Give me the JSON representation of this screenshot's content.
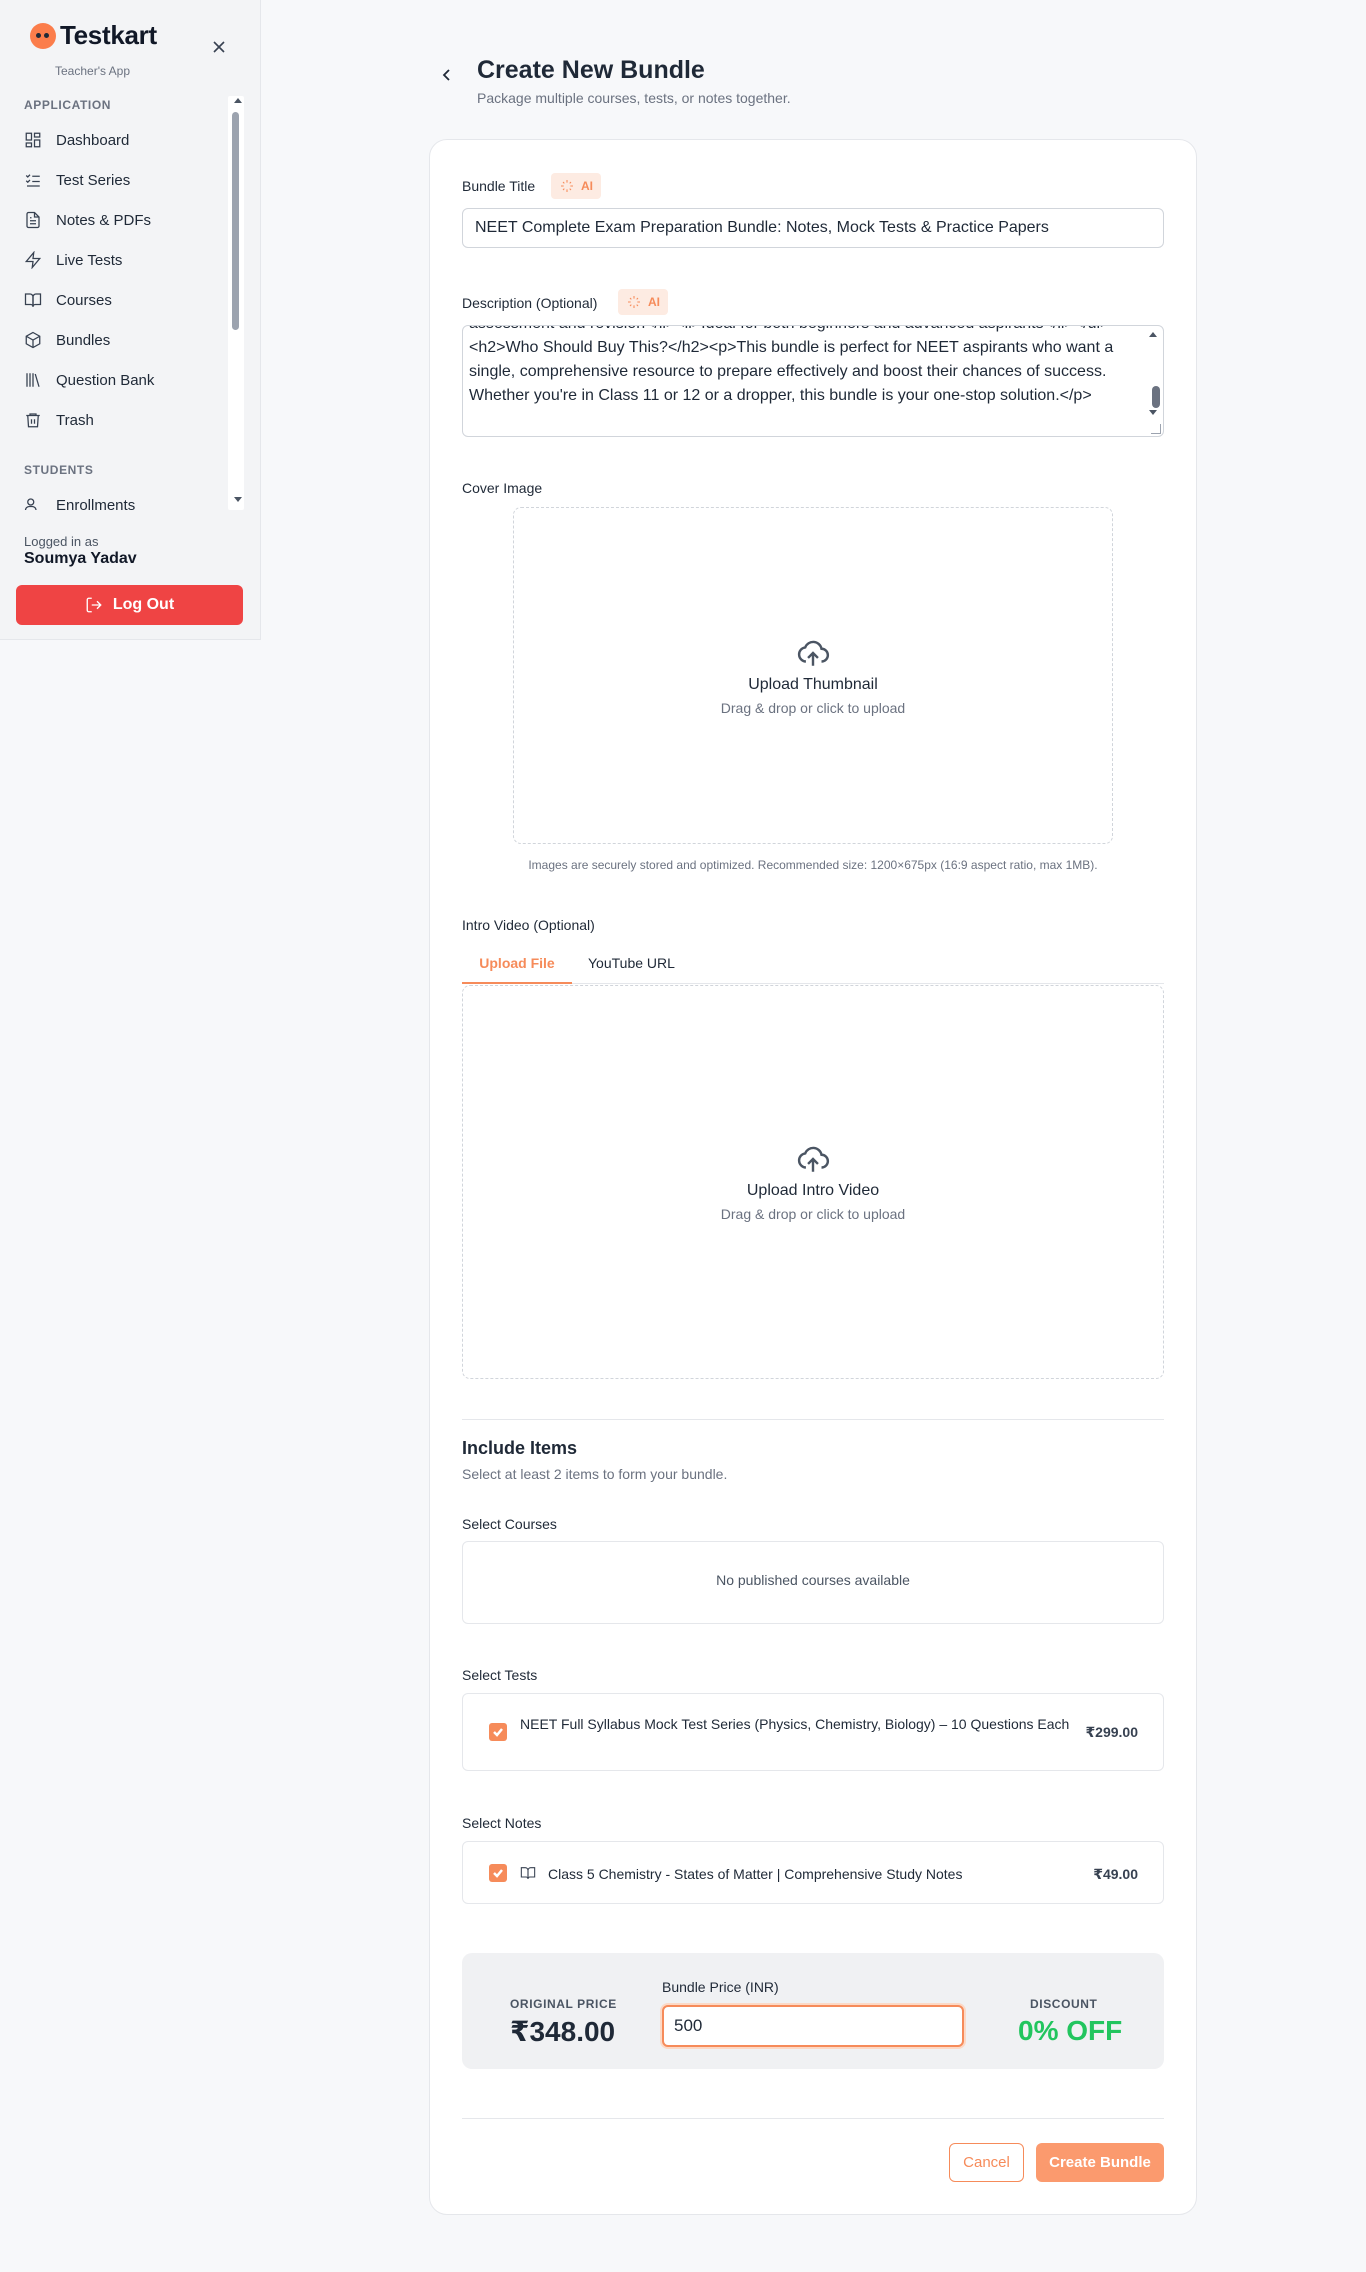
{
  "sidebar": {
    "brand_name": "Testkart",
    "brand_sub": "Teacher's App",
    "section_application": "APPLICATION",
    "items": [
      {
        "label": "Dashboard",
        "icon": "grid-icon"
      },
      {
        "label": "Test Series",
        "icon": "list-check-icon"
      },
      {
        "label": "Notes & PDFs",
        "icon": "file-text-icon"
      },
      {
        "label": "Live Tests",
        "icon": "lightning-icon"
      },
      {
        "label": "Courses",
        "icon": "book-open-icon"
      },
      {
        "label": "Bundles",
        "icon": "package-icon"
      },
      {
        "label": "Question Bank",
        "icon": "library-icon"
      },
      {
        "label": "Trash",
        "icon": "trash-icon"
      }
    ],
    "section_students": "STUDENTS",
    "students_items": [
      {
        "label": "Enrollments",
        "icon": "users-icon"
      }
    ],
    "logged_label": "Logged in as",
    "logged_name": "Soumya Yadav",
    "logout_label": "Log Out"
  },
  "header": {
    "title": "Create New Bundle",
    "subtitle": "Package multiple courses, tests, or notes together."
  },
  "form": {
    "title_label": "Bundle Title",
    "ai_label": "AI",
    "title_value": "NEET Complete Exam Preparation Bundle: Notes, Mock Tests & Practice Papers",
    "description_label": "Description (Optional)",
    "description_value": "assessment and revision</li><li>Ideal for both beginners and advanced aspirants</li></ul><h2>Who Should Buy This?</h2><p>This bundle is perfect for NEET aspirants who want a single, comprehensive resource to prepare effectively and boost their chances of success. Whether you're in Class 11 or 12 or a dropper, this bundle is your one-stop solution.</p>",
    "cover_label": "Cover Image",
    "cover_title": "Upload Thumbnail",
    "cover_sub": "Drag & drop or click to upload",
    "cover_help": "Images are securely stored and optimized. Recommended size: 1200×675px (16:9 aspect ratio, max 1MB).",
    "video_label": "Intro Video (Optional)",
    "video_tabs": [
      "Upload File",
      "YouTube URL"
    ],
    "video_title": "Upload Intro Video",
    "video_sub": "Drag & drop or click to upload"
  },
  "include": {
    "title": "Include Items",
    "subtitle": "Select at least 2 items to form your bundle.",
    "courses_label": "Select Courses",
    "courses_empty": "No published courses available",
    "tests_label": "Select Tests",
    "tests": [
      {
        "title": "NEET Full Syllabus Mock Test Series (Physics, Chemistry, Biology) – 10 Questions Each",
        "price": "₹299.00",
        "checked": true
      }
    ],
    "notes_label": "Select Notes",
    "notes": [
      {
        "title": "Class 5 Chemistry - States of Matter | Comprehensive Study Notes",
        "price": "₹49.00",
        "checked": true
      }
    ]
  },
  "pricing": {
    "original_label": "ORIGINAL PRICE",
    "original_value": "₹348.00",
    "bundle_label": "Bundle Price (INR)",
    "bundle_value": "500",
    "discount_label": "DISCOUNT",
    "discount_value": "0% OFF",
    "discount_color": "#22c55e"
  },
  "actions": {
    "cancel_label": "Cancel",
    "create_label": "Create Bundle"
  },
  "colors": {
    "accent": "#f68b5a",
    "danger": "#ef4444"
  }
}
